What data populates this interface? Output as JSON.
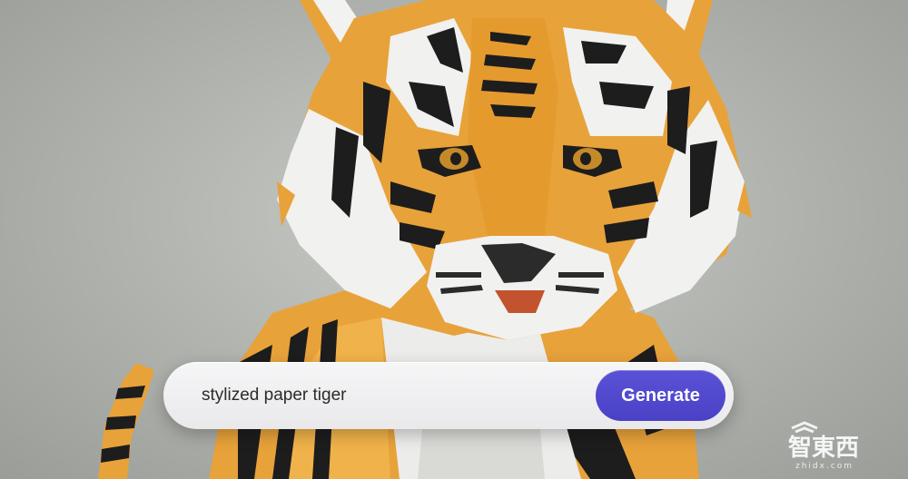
{
  "prompt": {
    "value": "stylized paper tiger",
    "placeholder": ""
  },
  "generate_button": {
    "label": "Generate",
    "color": "#4f47cc"
  },
  "watermark": {
    "text": "智東西",
    "subtext": "zhidx.com"
  },
  "colors": {
    "background": "#b3b6b1",
    "tiger_orange": "#e8a23a",
    "tiger_stripe": "#1d1d1d",
    "tiger_white": "#f1f1ef"
  }
}
